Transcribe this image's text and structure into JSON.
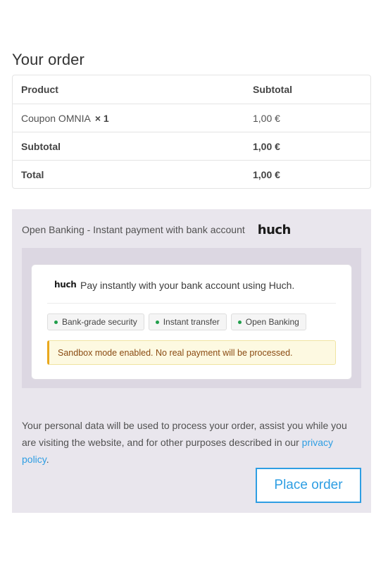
{
  "order": {
    "heading": "Your order",
    "columns": {
      "product": "Product",
      "subtotal": "Subtotal"
    },
    "items": [
      {
        "name": "Coupon OMNIA",
        "qty": "× 1",
        "subtotal": "1,00 €"
      }
    ],
    "subtotal_label": "Subtotal",
    "subtotal_value": "1,00 €",
    "total_label": "Total",
    "total_value": "1,00 €"
  },
  "payment": {
    "method_label": "Open Banking - Instant payment with bank account",
    "logo_text": "huch",
    "card": {
      "logo_text": "huch",
      "description": "Pay instantly with your bank account using Huch.",
      "badges": [
        "Bank-grade security",
        "Instant transfer",
        "Open Banking"
      ],
      "sandbox_notice": "Sandbox mode enabled. No real payment will be processed."
    }
  },
  "privacy": {
    "text_before": "Your personal data will be used to process your order, assist you while you are visiting the website, and for other purposes described in our ",
    "link_text": "privacy policy",
    "text_after": "."
  },
  "actions": {
    "place_order_label": "Place order"
  },
  "colors": {
    "accent": "#2e9ee3",
    "badge_dot": "#1f9e4a",
    "warning_border": "#e9a81d"
  }
}
